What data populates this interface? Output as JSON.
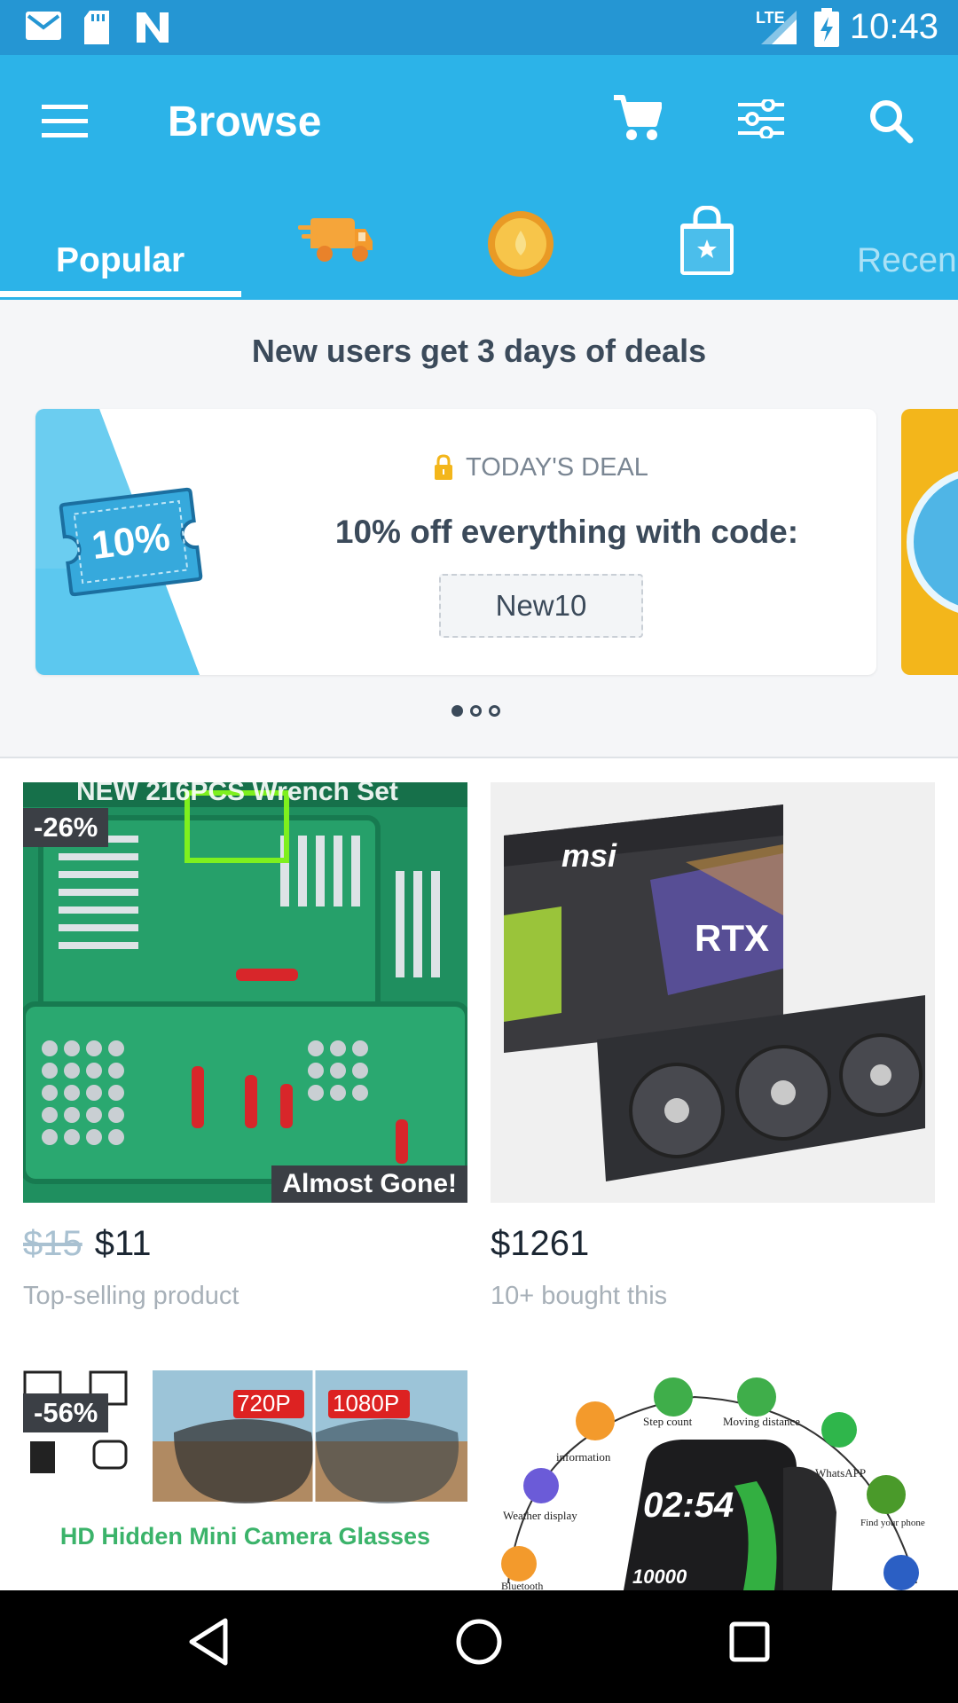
{
  "status_bar": {
    "time": "10:43",
    "network": "LTE",
    "left_icons": [
      "gmail-icon",
      "sd-card-icon",
      "n-app-icon"
    ],
    "right_icons": [
      "signal-icon",
      "battery-charging-icon"
    ]
  },
  "app_bar": {
    "title": "Browse",
    "icons": [
      "menu-icon",
      "cart-icon",
      "filter-icon",
      "search-icon"
    ]
  },
  "tabs": {
    "items": [
      {
        "label": "Popular",
        "selected": true
      },
      {
        "icon": "truck-icon"
      },
      {
        "icon": "coin-icon"
      },
      {
        "icon": "shopping-bag-star-icon"
      },
      {
        "label": "Recen"
      }
    ]
  },
  "banner": {
    "heading": "New users get 3 days of deals",
    "ticket_text": "10%",
    "label": "TODAY'S DEAL",
    "title": "10% off everything with code:",
    "code": "New10",
    "page_count": 3,
    "active_page": 1
  },
  "products": [
    {
      "image_title": "NEW 216PCS Wrench Set",
      "discount": "-26%",
      "tag": "Almost Gone!",
      "old_price": "$15",
      "price": "$11",
      "note": "Top-selling product"
    },
    {
      "image_title": "MSI Gaming Trio GeForce RTX",
      "price": "$1261",
      "note": "10+ bought this"
    },
    {
      "discount": "-56%",
      "caption": "HD Hidden Mini Camera Glasses",
      "res_a": "720P",
      "res_b": "1080P"
    },
    {
      "time_display": "02:54",
      "steps_display": "10000",
      "features": [
        "Step count",
        "Moving distance",
        "information",
        "WhatsAPP",
        "Weather display",
        "Find your phone",
        "Bluetooth"
      ]
    }
  ],
  "colors": {
    "primary": "#2cb3e8",
    "status_bar": "#2596d3",
    "text_dark": "#3b4a5a",
    "badge": "#3b3f45"
  },
  "nav_bar": {
    "icons": [
      "back-icon",
      "home-icon",
      "recents-icon"
    ]
  }
}
